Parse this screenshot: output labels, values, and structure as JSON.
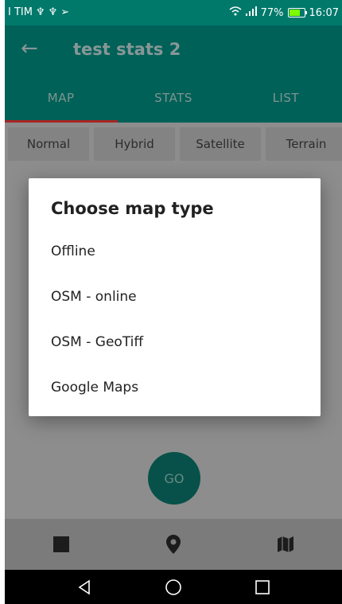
{
  "status_bar": {
    "carrier": "I TIM",
    "battery_percent": "77%",
    "time": "16:07",
    "battery_color": "#7CFC00"
  },
  "app_bar": {
    "title": "test stats 2",
    "tabs": [
      {
        "label": "MAP",
        "selected": true
      },
      {
        "label": "STATS",
        "selected": false
      },
      {
        "label": "LIST",
        "selected": false
      }
    ],
    "accent": "#009688",
    "indicator_color": "#ff3b3b"
  },
  "map": {
    "map_type_buttons": [
      "Normal",
      "Hybrid",
      "Satellite",
      "Terrain"
    ],
    "go_label": "GO"
  },
  "dialog": {
    "title": "Choose map type",
    "options": [
      "Offline",
      "OSM - online",
      "OSM - GeoTiff",
      "Google Maps"
    ]
  },
  "bottom_nav": {
    "icons": [
      "stop-icon",
      "location-pin-icon",
      "map-icon"
    ]
  },
  "system_nav": {
    "icons": [
      "back-icon",
      "home-icon",
      "recents-icon"
    ]
  }
}
